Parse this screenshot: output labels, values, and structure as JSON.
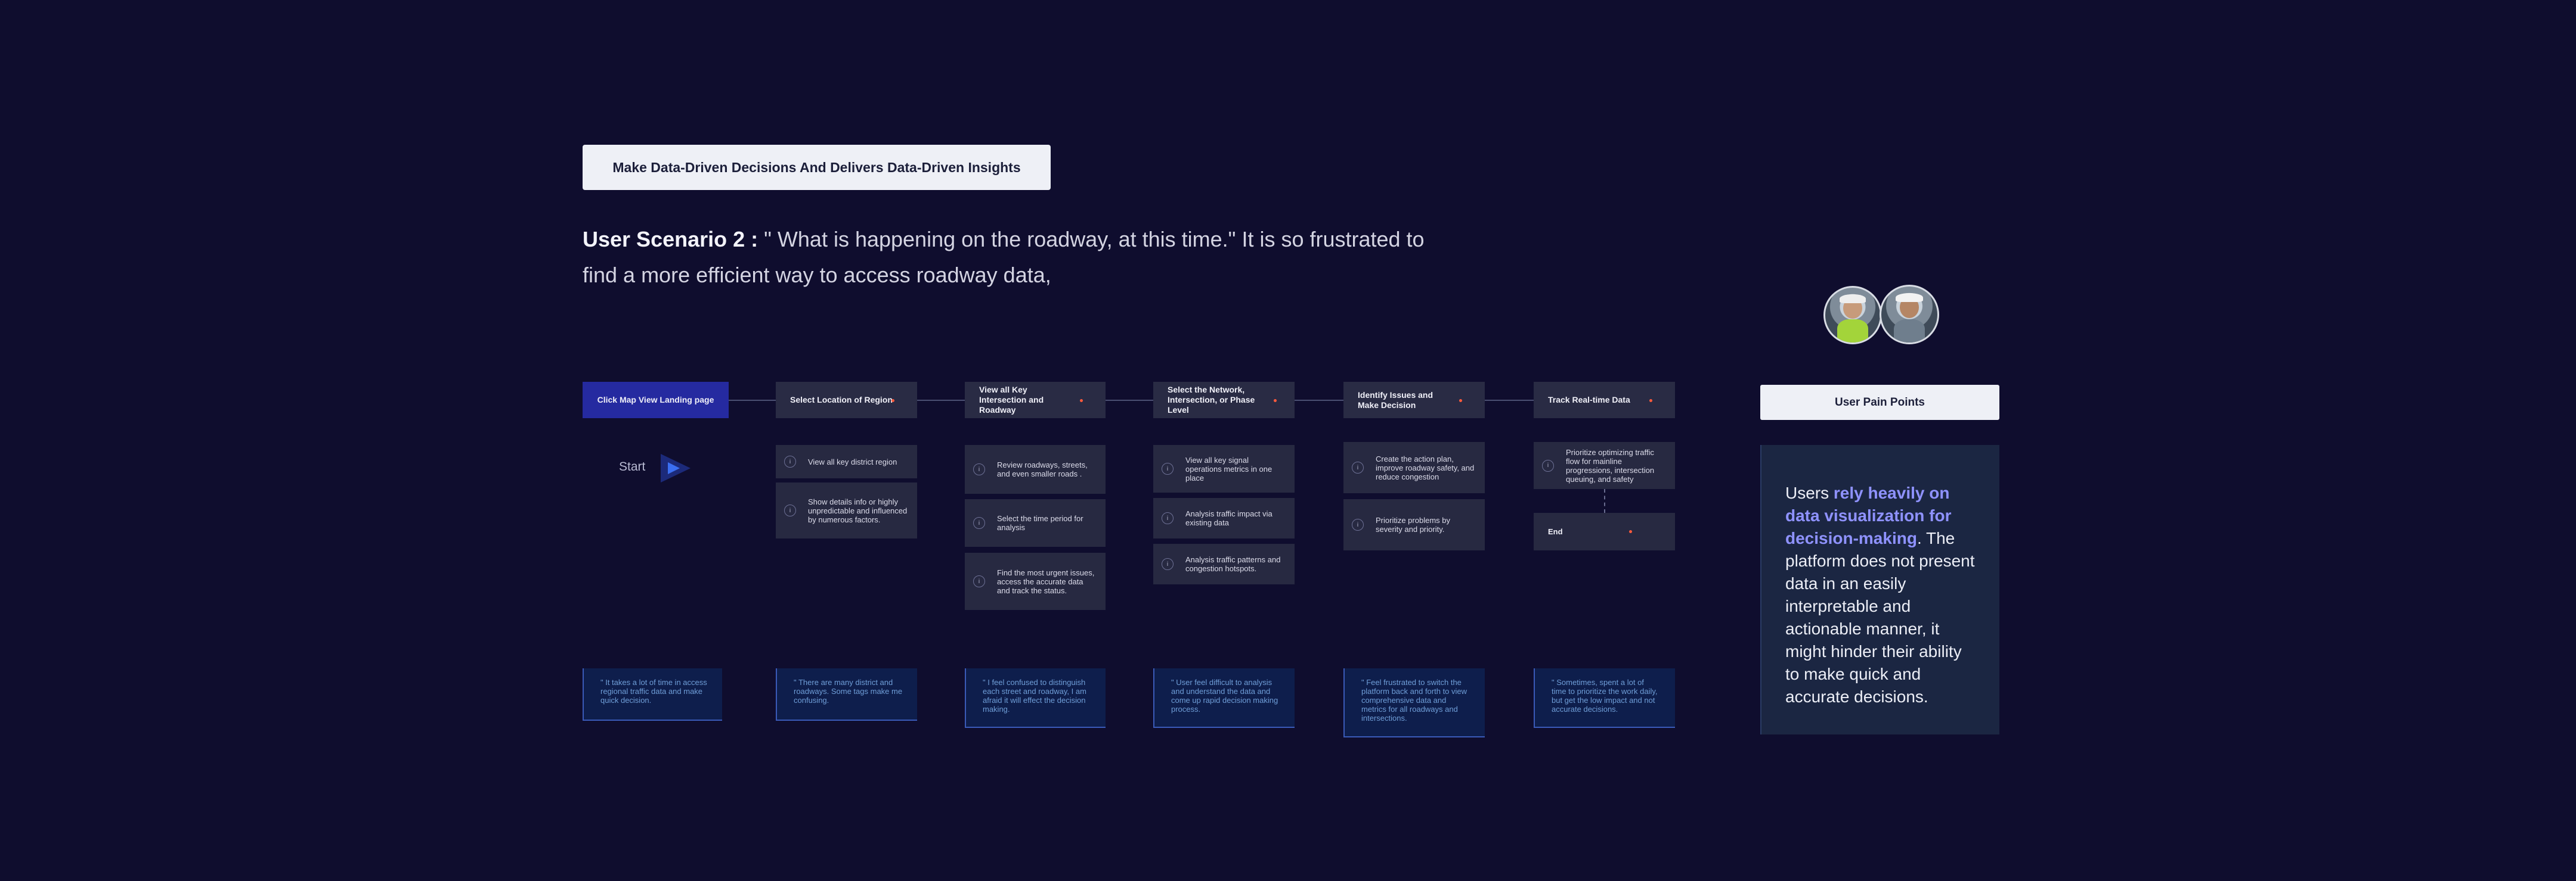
{
  "header": {
    "badge": "Make Data-Driven Decisions And Delivers Data-Driven Insights",
    "scenario_label": "User Scenario 2 :",
    "scenario_text": " \" What is happening on the roadway, at this time.\" It is so frustrated to find a more efficient way to access roadway data,"
  },
  "start": {
    "label": "Start"
  },
  "stages": [
    {
      "label": "Click Map View Landing page"
    },
    {
      "label": "Select Location of Region"
    },
    {
      "label": "View all Key Intersection and Roadway"
    },
    {
      "label": "Select the Network, Intersection, or Phase Level"
    },
    {
      "label": "Identify Issues and Make Decision"
    },
    {
      "label": "Track Real-time Data"
    }
  ],
  "steps": {
    "region": [
      {
        "num": "i",
        "text": "View all key district region"
      },
      {
        "num": "i",
        "text": "Show details info or highly unpredictable and influenced by numerous factors."
      }
    ],
    "intersection": [
      {
        "num": "i",
        "text": "Review roadways, streets, and even smaller roads ."
      },
      {
        "num": "i",
        "text": "Select the time period for analysis"
      },
      {
        "num": "i",
        "text": "Find the most urgent issues, access the accurate data and track the status."
      }
    ],
    "network": [
      {
        "num": "i",
        "text": "View all key signal operations metrics in one place"
      },
      {
        "num": "i",
        "text": "Analysis traffic impact via existing data"
      },
      {
        "num": "i",
        "text": "Analysis traffic patterns and congestion hotspots."
      }
    ],
    "decision": [
      {
        "num": "i",
        "text": "Create the action plan, improve roadway safety, and reduce congestion"
      },
      {
        "num": "i",
        "text": "Prioritize problems by severity and priority."
      }
    ],
    "track": [
      {
        "num": "i",
        "text": "Prioritize optimizing traffic flow for mainline progressions, intersection queuing, and safety"
      }
    ],
    "end_label": "End"
  },
  "quotes": [
    "\" It takes a lot of time in access regional traffic data and make quick decision.",
    "\" There are many district and roadways. Some tags make me confusing.",
    "\" I feel confused to distinguish each street and roadway, I am afraid it will effect the decision making.",
    "\" User feel difficult to analysis and understand the data and come up rapid decision making process.",
    "\" Feel frustrated to switch the platform back and forth to view comprehensive data and metrics for all roadways and intersections.",
    "\" Sometimes, spent a lot of time to prioritize the work daily, but get the low impact and not accurate decisions."
  ],
  "pain_points": {
    "title": "User Pain Points",
    "lead": "Users ",
    "highlight": "rely heavily on data visualization for decision-making",
    "rest": ". The platform does not present data in an easily interpretable and actionable manner, it might hinder their ability to make quick and accurate decisions."
  },
  "colors": {
    "background": "#0f0d2e",
    "primary_stage": "#252aa0",
    "stage": "#292b44",
    "step": "#272941",
    "quote_bg": "#0e1e4c",
    "quote_text": "#6f9ed8",
    "highlight": "#8f92ff",
    "status_dot": "#ff5a3c",
    "start_arrow": "#3b6ff2"
  },
  "icons": [
    "avatar-engineer",
    "avatar-worker",
    "play-arrow-icon",
    "info-icon"
  ]
}
